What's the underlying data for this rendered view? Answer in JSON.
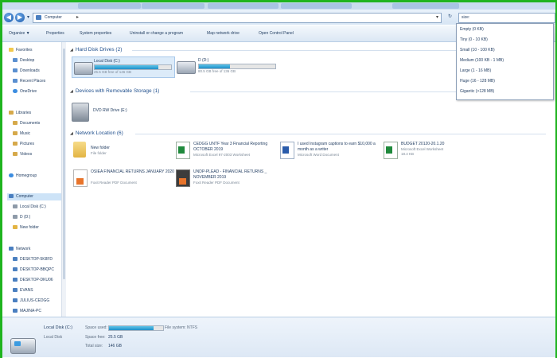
{
  "window": {
    "tabs": [
      "",
      "",
      "",
      "",
      ""
    ]
  },
  "address": {
    "path": "Computer",
    "search_value": "size:"
  },
  "toolbar": {
    "organize": "Organize ▼",
    "properties": "Properties",
    "system_properties": "System properties",
    "uninstall": "Uninstall or change a program",
    "map_drive": "Map network drive",
    "control_panel": "Open Control Panel"
  },
  "sidebar": {
    "items": [
      {
        "label": "Favorites",
        "color": "#f2c94c"
      },
      {
        "label": "Desktop",
        "color": "#5a8fd0"
      },
      {
        "label": "Downloads",
        "color": "#5a8fd0"
      },
      {
        "label": "Recent Places",
        "color": "#5a8fd0"
      },
      {
        "label": "OneDrive",
        "color": "#3c8de0"
      },
      {
        "label": "Libraries",
        "color": "#d6a94a"
      },
      {
        "label": "Documents",
        "color": "#d6a94a"
      },
      {
        "label": "Music",
        "color": "#d6a94a"
      },
      {
        "label": "Pictures",
        "color": "#d6a94a"
      },
      {
        "label": "Videos",
        "color": "#d6a94a"
      },
      {
        "label": "Homegroup",
        "color": "#3c8de0"
      },
      {
        "label": "Computer",
        "color": "#4a7fc0"
      },
      {
        "label": "Local Disk (C:)",
        "color": "#8e9aa8"
      },
      {
        "label": "D (D:)",
        "color": "#8e9aa8"
      },
      {
        "label": "New folder",
        "color": "#e3b443"
      },
      {
        "label": "Network",
        "color": "#4a7fc0"
      },
      {
        "label": "DESKTOP-5K8FD",
        "color": "#4a7fc0"
      },
      {
        "label": "DESKTOP-BBQPC",
        "color": "#4a7fc0"
      },
      {
        "label": "DESKTOP-DKU06",
        "color": "#4a7fc0"
      },
      {
        "label": "EVANS",
        "color": "#4a7fc0"
      },
      {
        "label": "JULIUS-CEDGG",
        "color": "#4a7fc0"
      },
      {
        "label": "MAJINA-PC",
        "color": "#4a7fc0"
      }
    ]
  },
  "groups": {
    "hdd": "Hard Disk Drives (2)",
    "removable": "Devices with Removable Storage (1)",
    "network": "Network Location (6)"
  },
  "drives": [
    {
      "name": "Local Disk (C:)",
      "free": "25.5 GB free of 146 GB",
      "used_fraction": 0.83
    },
    {
      "name": "D (D:)",
      "free": "80.5 GB free of 136 GB",
      "used_fraction": 0.41
    }
  ],
  "removable": [
    {
      "name": "DVD RW Drive (E:)"
    }
  ],
  "network_items": [
    {
      "name": "New folder",
      "type": "File folder",
      "kind": "folder"
    },
    {
      "name": "CEDGG UNTF Year 3 Financial Reporting   OCTOBER 2019",
      "type": "Microsoft Excel 97-2003 Worksheet",
      "kind": "xls"
    },
    {
      "name": "I used Instagram captions to earn $10,000 a month as a writer",
      "type": "Microsoft Word Document",
      "kind": "doc"
    },
    {
      "name": "BUDGET 20120-20.1.20",
      "type": "Microsoft Excel Worksheet",
      "size": "18.4 KB",
      "kind": "xls"
    },
    {
      "name": "OSIEA FINANCIAL RETURNS JANUARY 2020",
      "type": "Foxit Reader PDF Document",
      "kind": "pdf"
    },
    {
      "name": "UNDP-PLEAD - FINANCIAL RETURNS _ NOVEMBER 2019",
      "type": "Foxit Reader PDF Document",
      "kind": "pdf2"
    }
  ],
  "size_filter_options": [
    "Empty (0 KB)",
    "Tiny (0 - 10 KB)",
    "Small (10 - 100 KB)",
    "Medium (100 KB - 1 MB)",
    "Large (1 - 16 MB)",
    "Huge (16 - 128 MB)",
    "Gigantic (>128 MB)"
  ],
  "details": {
    "name": "Local Disk (C:)",
    "subtitle": "Local Disk",
    "space_used_label": "Space used:",
    "space_used_fraction": 0.83,
    "file_system_label": "File system: NTFS",
    "space_free_label": "Space free:",
    "space_free_value": "25.5 GB",
    "total_size_label": "Total size:",
    "total_size_value": "146 GB"
  }
}
